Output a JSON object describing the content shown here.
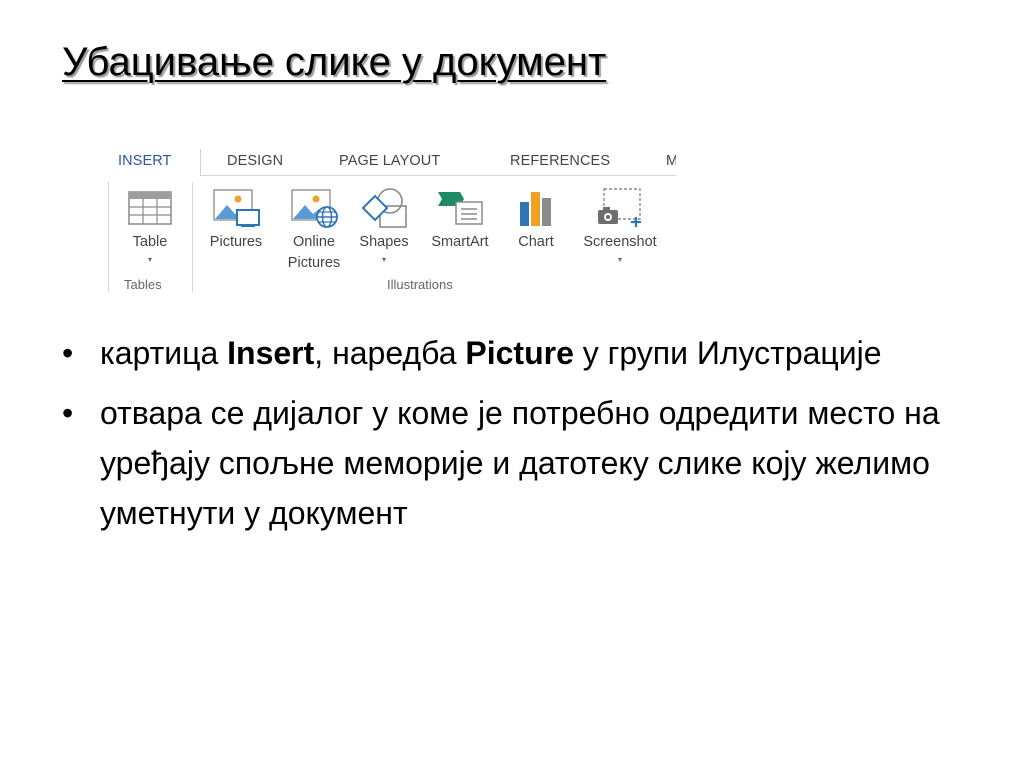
{
  "slide": {
    "title": "Убацивање слике у документ"
  },
  "ribbon": {
    "tabs": [
      "INSERT",
      "DESIGN",
      "PAGE LAYOUT",
      "REFERENCES",
      "M"
    ],
    "groups": {
      "tables": {
        "label": "Tables",
        "commands": [
          {
            "label": "Table",
            "icon": "table-icon",
            "has_dropdown": true
          }
        ]
      },
      "illustrations": {
        "label": "Illustrations",
        "commands": [
          {
            "label": "Pictures",
            "icon": "pictures-icon"
          },
          {
            "label_line1": "Online",
            "label_line2": "Pictures",
            "icon": "online-pictures-icon"
          },
          {
            "label": "Shapes",
            "icon": "shapes-icon",
            "has_dropdown": true
          },
          {
            "label": "SmartArt",
            "icon": "smartart-icon"
          },
          {
            "label": "Chart",
            "icon": "chart-icon"
          },
          {
            "label": "Screenshot",
            "icon": "screenshot-icon",
            "has_dropdown": true
          }
        ]
      }
    },
    "dropdown_glyph": "▾",
    "colors": {
      "active_tab": "#2b579a",
      "icon_blue": "#2e75b6",
      "icon_green": "#1e8a66",
      "chart_orange": "#f2a024",
      "text": "#444444"
    }
  },
  "bullets": {
    "glyph": "•",
    "item1": {
      "t1": "картица ",
      "b1": "Insert",
      "t2": ", наредба ",
      "b2": "Picture",
      "t3": " у групи Илустрације"
    },
    "item2": {
      "text": "отвара се дијалог у коме је потребно одредити место на уређају спољне меморије и датотеку слике коју желимо уметнути у документ"
    }
  }
}
